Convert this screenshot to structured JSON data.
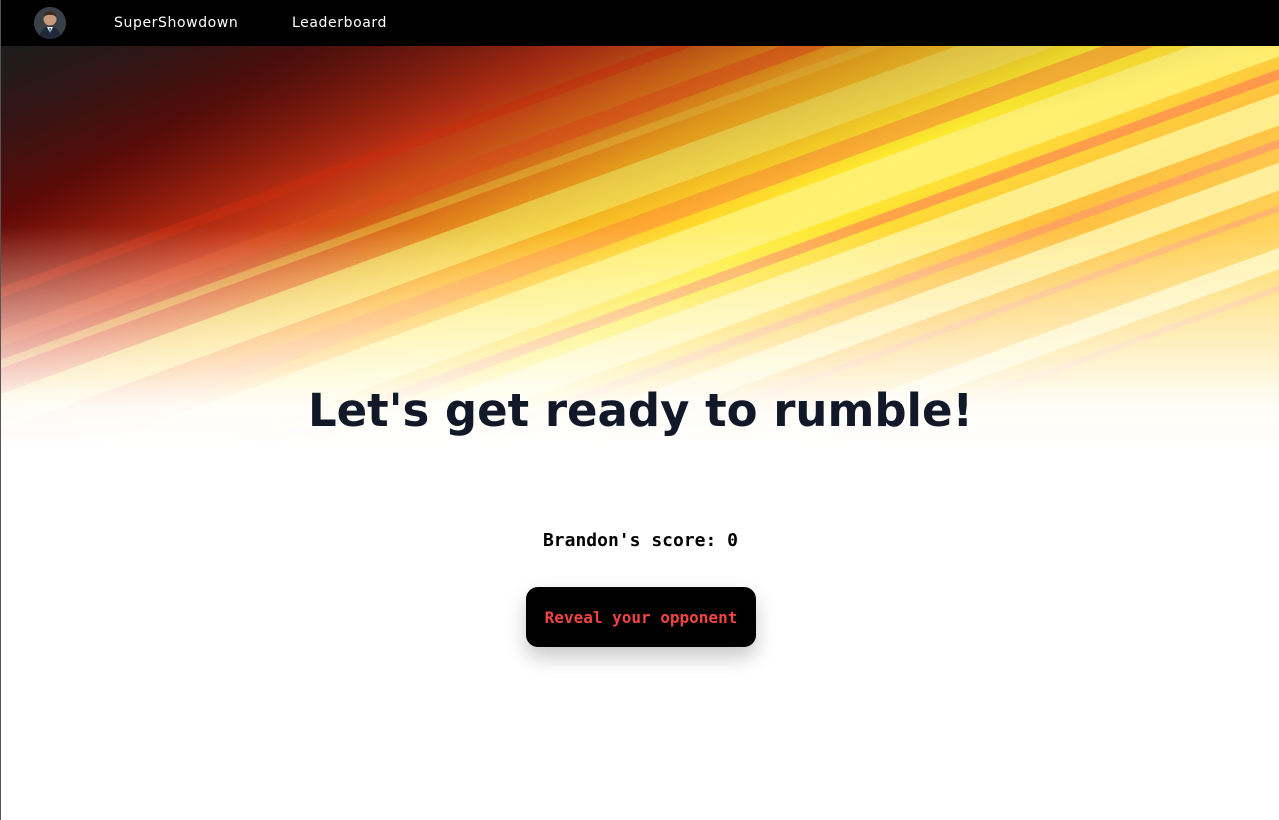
{
  "nav": {
    "brand": "SuperShowdown",
    "leaderboard": "Leaderboard"
  },
  "main": {
    "headline": "Let's get ready to rumble!",
    "score_label": "Brandon's score: 0",
    "reveal_button": "Reveal your opponent"
  },
  "colors": {
    "navbar_bg": "#000000",
    "headline": "#111827",
    "button_bg": "#000000",
    "button_text": "#ef4444"
  },
  "icons": {
    "avatar": "user-avatar-photo"
  }
}
